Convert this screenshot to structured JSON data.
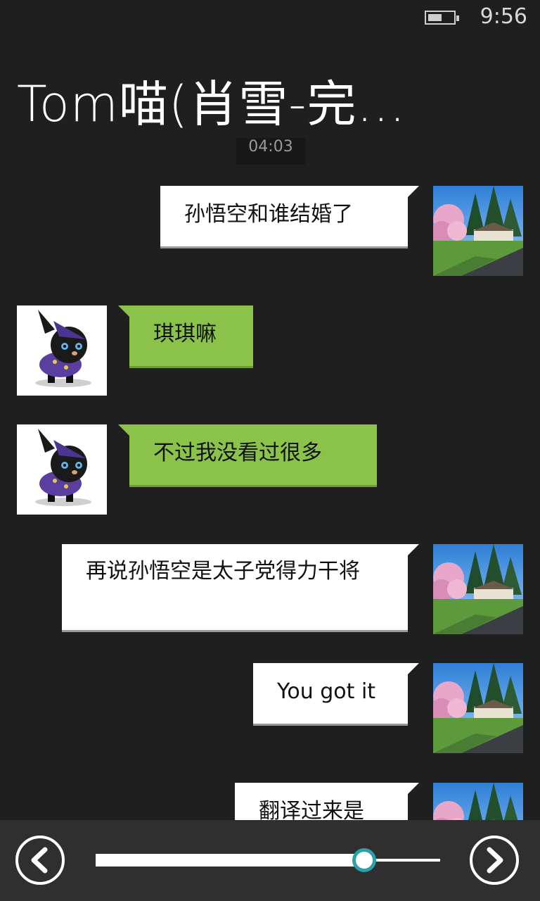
{
  "status_bar": {
    "time": "9:56",
    "battery_level": 0.55
  },
  "conversation": {
    "title": "Tom喵(肖雪-完...",
    "timestamp": "04:03"
  },
  "messages": [
    {
      "sender": "me",
      "text": "孙悟空和谁结婚了"
    },
    {
      "sender": "them",
      "text": "琪琪嘛"
    },
    {
      "sender": "them",
      "text": "不过我没看过很多"
    },
    {
      "sender": "me",
      "text": "再说孙悟空是太子党得力干将"
    },
    {
      "sender": "me",
      "text": "You got it"
    },
    {
      "sender": "me",
      "text": "翻译过来是"
    }
  ],
  "avatars": {
    "me": "landscape-avatar",
    "them": "black-cat-wizard-avatar"
  },
  "playback": {
    "prev_icon": "chevron-left-icon",
    "next_icon": "chevron-right-icon",
    "progress": 0.78
  },
  "colors": {
    "background": "#1f1f1f",
    "them_bubble": "#8bc34a",
    "me_bubble": "#ffffff",
    "accent": "#2aa0a8",
    "bottom_bar": "#2f2f2f"
  }
}
